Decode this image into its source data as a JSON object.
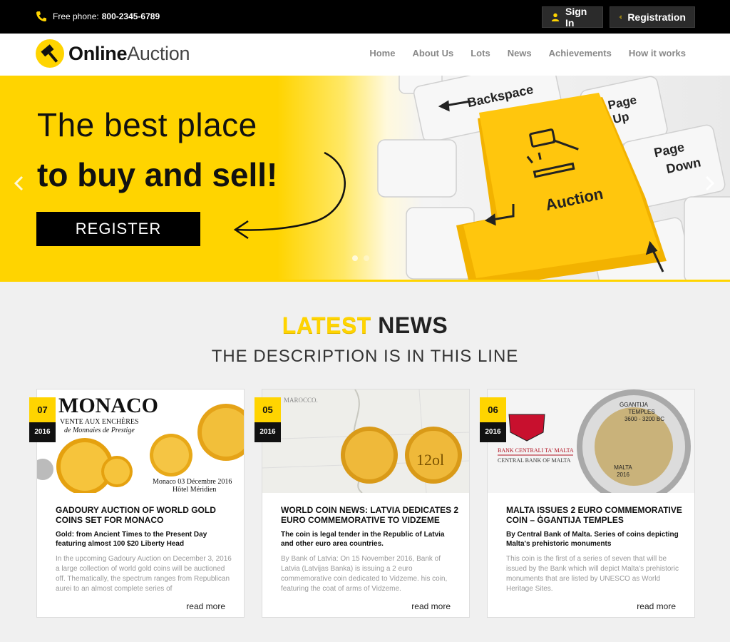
{
  "topbar": {
    "phone_label": "Free phone:",
    "phone_number": "800-2345-6789",
    "signin_label": "Sign In",
    "register_label": "Registration"
  },
  "header": {
    "logo_bold": "Online",
    "logo_light": "Auction",
    "nav": [
      "Home",
      "About Us",
      "Lots",
      "News",
      "Achievements",
      "How it works"
    ]
  },
  "hero": {
    "line1": "The best place",
    "line2": "to buy and sell!",
    "cta": "REGISTER",
    "keys": {
      "backspace": "Backspace",
      "page_up_1": "Page",
      "page_up_2": "Up",
      "page_down_1": "Page",
      "page_down_2": "Down",
      "auction": "Auction"
    }
  },
  "section": {
    "title_highlight": "LATEST",
    "title_rest": "NEWS",
    "subtitle": "THE DESCRIPTION IS IN THIS LINE"
  },
  "cards": [
    {
      "day": "07",
      "year": "2016",
      "title": "GADOURY AUCTION OF WORLD GOLD COINS SET FOR MONACO",
      "subtitle": "Gold: from Ancient Times to the Present Day featuring almost 100 $20 Liberty Head",
      "text": "In the upcoming Gadoury Auction on December 3, 2016 a large collection of world gold coins will be auctioned off. Thematically, the spectrum ranges from Republican aurei to an almost complete series of",
      "more": "read more",
      "img_title": "MONACO",
      "img_sub": "VENTE AUX ENCHÈRES",
      "img_sub2": "de Monnaies de Prestige",
      "img_date": "Monaco 03 Décembre 2016",
      "img_place": "Hôtel Méridien"
    },
    {
      "day": "05",
      "year": "2016",
      "title": "WORLD COIN NEWS: LATVIA DEDICATES 2 EURO COMMEMORATIVE TO VIDZEME",
      "subtitle": "The coin is legal tender in the Republic of Latvia and other euro area countries.",
      "text": "By Bank of Latvia: On 15 November 2016, Bank of Latvia (Latvijas Banka) is issuing a 2 euro commemorative coin dedicated to Vidzeme. his coin, featuring the coat of arms of Vidzeme.",
      "more": "read more",
      "img_map": "MAROCCO.",
      "img_coin": "12ol"
    },
    {
      "day": "06",
      "year": "2016",
      "title": "MALTA ISSUES 2 EURO COMMEMORATIVE COIN – ĠGANTIJA TEMPLES",
      "subtitle": "By Central Bank of Malta. Series of coins depicting Malta's prehistoric monuments",
      "text": "This coin is the first of a series of seven that will be issued by the Bank which will depict Malta's prehistoric monuments that are listed by UNESCO as World Heritage Sites.",
      "more": "read more",
      "img_bank1": "BANK CENTRALI TA' MALTA",
      "img_bank2": "CENTRAL BANK OF MALTA",
      "img_coin1": "ĠGANTIJA",
      "img_coin2": "TEMPLES",
      "img_coin3": "3600 - 3200 BC",
      "img_coin4": "MALTA",
      "img_coin5": "2016"
    }
  ],
  "colors": {
    "accent": "#ffd400",
    "dark": "#000000"
  }
}
